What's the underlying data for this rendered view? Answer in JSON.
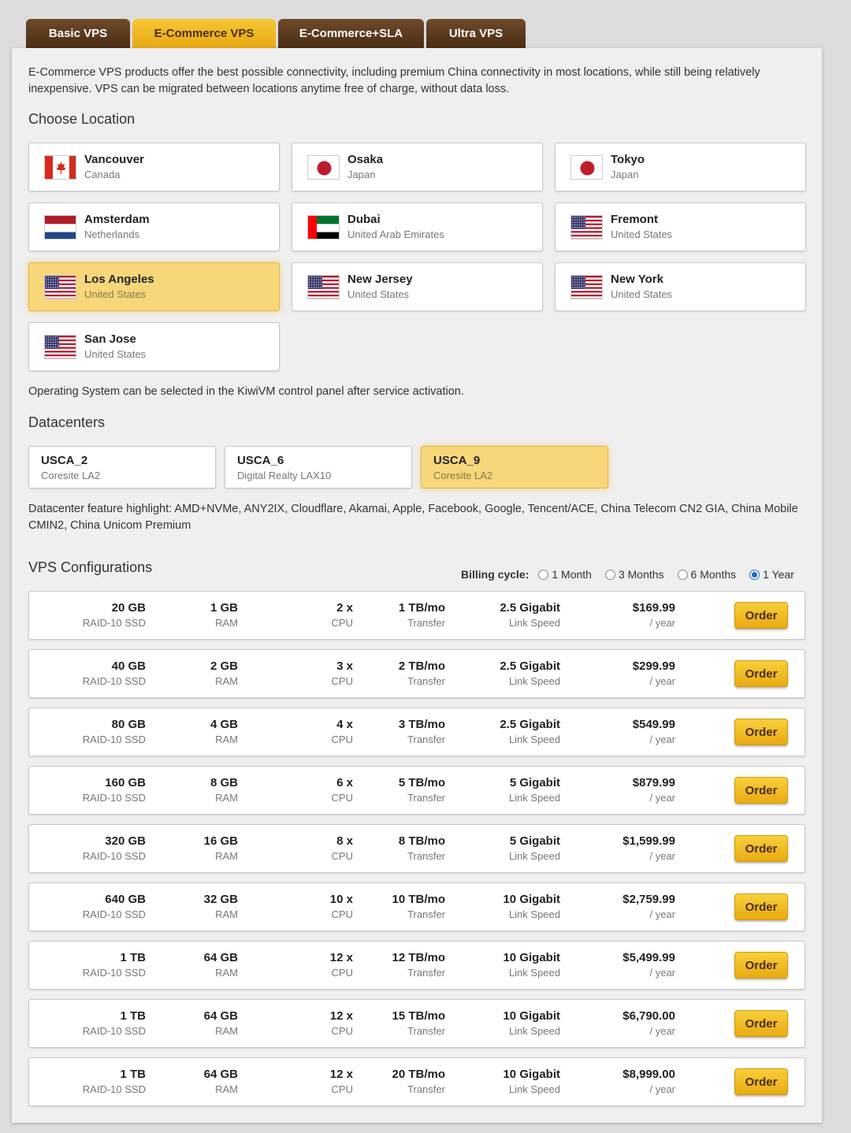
{
  "tabs": [
    {
      "label": "Basic VPS",
      "active": false
    },
    {
      "label": "E-Commerce VPS",
      "active": true
    },
    {
      "label": "E-Commerce+SLA",
      "active": false
    },
    {
      "label": "Ultra VPS",
      "active": false
    }
  ],
  "intro": "E-Commerce VPS products offer the best possible connectivity, including premium China connectivity in most locations, while still being relatively inexpensive. VPS can be migrated between locations anytime free of charge, without data loss.",
  "location_title": "Choose Location",
  "locations": [
    {
      "city": "Vancouver",
      "country": "Canada",
      "flag": "canada-flag-icon",
      "selected": false
    },
    {
      "city": "Osaka",
      "country": "Japan",
      "flag": "japan-flag-icon",
      "selected": false
    },
    {
      "city": "Tokyo",
      "country": "Japan",
      "flag": "japan-flag-icon",
      "selected": false
    },
    {
      "city": "Amsterdam",
      "country": "Netherlands",
      "flag": "netherlands-flag-icon",
      "selected": false
    },
    {
      "city": "Dubai",
      "country": "United Arab Emirates",
      "flag": "uae-flag-icon",
      "selected": false
    },
    {
      "city": "Fremont",
      "country": "United States",
      "flag": "us-flag-icon",
      "selected": false
    },
    {
      "city": "Los Angeles",
      "country": "United States",
      "flag": "us-flag-icon",
      "selected": true
    },
    {
      "city": "New Jersey",
      "country": "United States",
      "flag": "us-flag-icon",
      "selected": false
    },
    {
      "city": "New York",
      "country": "United States",
      "flag": "us-flag-icon",
      "selected": false
    },
    {
      "city": "San Jose",
      "country": "United States",
      "flag": "us-flag-icon",
      "selected": false
    }
  ],
  "os_note": "Operating System can be selected in the KiwiVM control panel after service activation.",
  "datacenter_title": "Datacenters",
  "datacenters": [
    {
      "name": "USCA_2",
      "sub": "Coresite LA2",
      "selected": false
    },
    {
      "name": "USCA_6",
      "sub": "Digital Realty LAX10",
      "selected": false
    },
    {
      "name": "USCA_9",
      "sub": "Coresite LA2",
      "selected": true
    }
  ],
  "dc_feature": "Datacenter feature highlight: AMD+NVMe, ANY2IX, Cloudflare, Akamai, Apple, Facebook, Google, Tencent/ACE, China Telecom CN2 GIA, China Mobile CMIN2, China Unicom Premium",
  "config_title": "VPS Configurations",
  "billing": {
    "label": "Billing cycle:",
    "options": [
      {
        "label": "1 Month",
        "checked": false
      },
      {
        "label": "3 Months",
        "checked": false
      },
      {
        "label": "6 Months",
        "checked": false
      },
      {
        "label": "1 Year",
        "checked": true
      }
    ]
  },
  "units": {
    "disk": "RAID-10 SSD",
    "ram": "RAM",
    "cpu": "CPU",
    "transfer": "Transfer",
    "link": "Link Speed",
    "period": "/ year"
  },
  "order_label": "Order",
  "colors": {
    "accent": "#f2bc2a",
    "tab_dark": "#5c3a1e",
    "selected_bg": "#f7d77a"
  },
  "plans": [
    {
      "disk": "20 GB",
      "ram": "1 GB",
      "cpu": "2 x",
      "transfer": "1 TB/mo",
      "link": "2.5 Gigabit",
      "price": "$169.99"
    },
    {
      "disk": "40 GB",
      "ram": "2 GB",
      "cpu": "3 x",
      "transfer": "2 TB/mo",
      "link": "2.5 Gigabit",
      "price": "$299.99"
    },
    {
      "disk": "80 GB",
      "ram": "4 GB",
      "cpu": "4 x",
      "transfer": "3 TB/mo",
      "link": "2.5 Gigabit",
      "price": "$549.99"
    },
    {
      "disk": "160 GB",
      "ram": "8 GB",
      "cpu": "6 x",
      "transfer": "5 TB/mo",
      "link": "5 Gigabit",
      "price": "$879.99"
    },
    {
      "disk": "320 GB",
      "ram": "16 GB",
      "cpu": "8 x",
      "transfer": "8 TB/mo",
      "link": "5 Gigabit",
      "price": "$1,599.99"
    },
    {
      "disk": "640 GB",
      "ram": "32 GB",
      "cpu": "10 x",
      "transfer": "10 TB/mo",
      "link": "10 Gigabit",
      "price": "$2,759.99"
    },
    {
      "disk": "1 TB",
      "ram": "64 GB",
      "cpu": "12 x",
      "transfer": "12 TB/mo",
      "link": "10 Gigabit",
      "price": "$5,499.99"
    },
    {
      "disk": "1 TB",
      "ram": "64 GB",
      "cpu": "12 x",
      "transfer": "15 TB/mo",
      "link": "10 Gigabit",
      "price": "$6,790.00"
    },
    {
      "disk": "1 TB",
      "ram": "64 GB",
      "cpu": "12 x",
      "transfer": "20 TB/mo",
      "link": "10 Gigabit",
      "price": "$8,999.00"
    }
  ]
}
